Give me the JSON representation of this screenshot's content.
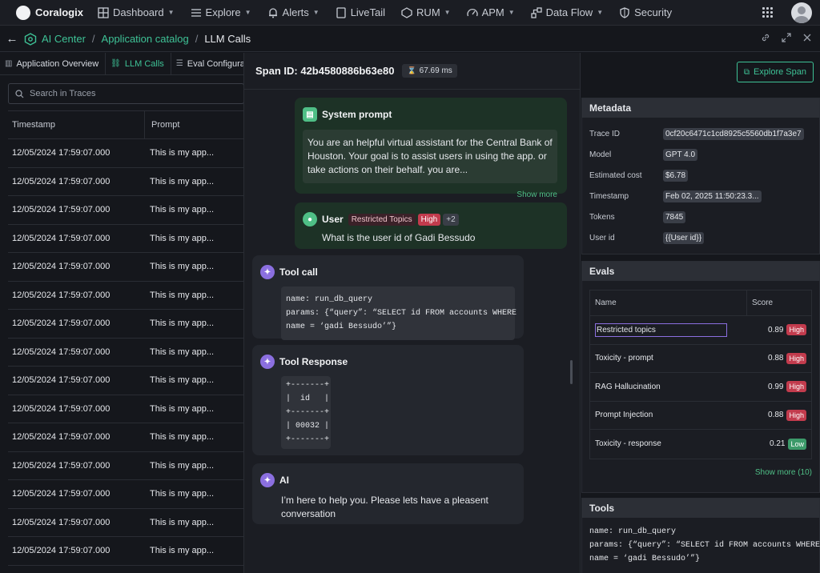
{
  "topnav": {
    "brand": "Coralogix",
    "items": [
      {
        "label": "Dashboard",
        "icon": "dashboard-icon",
        "caret": true
      },
      {
        "label": "Explore",
        "icon": "explore-icon",
        "caret": true
      },
      {
        "label": "Alerts",
        "icon": "bell-icon",
        "caret": true
      },
      {
        "label": "LiveTail",
        "icon": "livetail-icon",
        "caret": false
      },
      {
        "label": "RUM",
        "icon": "rum-icon",
        "caret": true
      },
      {
        "label": "APM",
        "icon": "apm-icon",
        "caret": true
      },
      {
        "label": "Data Flow",
        "icon": "dataflow-icon",
        "caret": true
      },
      {
        "label": "Security",
        "icon": "shield-icon",
        "caret": false
      }
    ]
  },
  "breadcrumb": {
    "items": [
      "AI Center",
      "Application catalog",
      "LLM Calls"
    ]
  },
  "left": {
    "tabs": [
      {
        "label": "Application Overview",
        "active": false
      },
      {
        "label": "LLM Calls",
        "active": true
      },
      {
        "label": "Eval Configuratio",
        "active": false
      }
    ],
    "search_placeholder": "Search in Traces",
    "columns": [
      "Timestamp",
      "Prompt"
    ],
    "rows": [
      {
        "ts": "12/05/2024  17:59:07.000",
        "prompt": "This is my app..."
      },
      {
        "ts": "12/05/2024  17:59:07.000",
        "prompt": "This is my app..."
      },
      {
        "ts": "12/05/2024  17:59:07.000",
        "prompt": "This is my app..."
      },
      {
        "ts": "12/05/2024  17:59:07.000",
        "prompt": "This is my app..."
      },
      {
        "ts": "12/05/2024  17:59:07.000",
        "prompt": "This is my app..."
      },
      {
        "ts": "12/05/2024  17:59:07.000",
        "prompt": "This is my app..."
      },
      {
        "ts": "12/05/2024  17:59:07.000",
        "prompt": "This is my app..."
      },
      {
        "ts": "12/05/2024  17:59:07.000",
        "prompt": "This is my app..."
      },
      {
        "ts": "12/05/2024  17:59:07.000",
        "prompt": "This is my app..."
      },
      {
        "ts": "12/05/2024  17:59:07.000",
        "prompt": "This is my app..."
      },
      {
        "ts": "12/05/2024  17:59:07.000",
        "prompt": "This is my app..."
      },
      {
        "ts": "12/05/2024  17:59:07.000",
        "prompt": "This is my app..."
      },
      {
        "ts": "12/05/2024  17:59:07.000",
        "prompt": "This is my app..."
      },
      {
        "ts": "12/05/2024  17:59:07.000",
        "prompt": "This is my app..."
      },
      {
        "ts": "12/05/2024  17:59:07.000",
        "prompt": "This is my app..."
      }
    ]
  },
  "span": {
    "title": "Span ID: 42b4580886b63e80",
    "duration": "67.69 ms",
    "explore_label": "Explore Span",
    "system": {
      "title": "System prompt",
      "text": "You are an helpful virtual assistant for the Central Bank of Houston. Your goal is to assist users in using the app. or take actions on their behalf.  you are...",
      "show_more": "Show more"
    },
    "user": {
      "title": "User",
      "tag": "Restricted Topics",
      "level": "High",
      "extra": "+2",
      "text": "What is the user id of Gadi Bessudo"
    },
    "tool_call": {
      "title": "Tool call",
      "code": "name: run_db_query\nparams: {“query”: “SELECT id FROM accounts WHERE\nname = ‘gadi Bessudo’”}"
    },
    "tool_response": {
      "title": "Tool Response",
      "code": "+-------+\n|  id   |\n+-------+\n| 00032 |\n+-------+"
    },
    "ai": {
      "title": "AI",
      "text": "I’m here to help you. Please lets have a pleasent conversation"
    }
  },
  "metadata": {
    "title": "Metadata",
    "rows": [
      {
        "key": "Trace ID",
        "value": "0cf20c6471c1cd8925c5560db1f7a3e7"
      },
      {
        "key": "Model",
        "value": "GPT 4.0"
      },
      {
        "key": "Estimated cost",
        "value": "$6.78"
      },
      {
        "key": "Timestamp",
        "value": "Feb 02, 2025 11:50:23.3..."
      },
      {
        "key": "Tokens",
        "value": "7845"
      },
      {
        "key": "User id",
        "value": "{{User id}}"
      }
    ]
  },
  "evals": {
    "title": "Evals",
    "columns": [
      "Name",
      "Score"
    ],
    "rows": [
      {
        "name": "Restricted topics",
        "score": "0.89",
        "level": "High",
        "selected": true
      },
      {
        "name": "Toxicity - prompt",
        "score": "0.88",
        "level": "High",
        "selected": false
      },
      {
        "name": "RAG Hallucination",
        "score": "0.99",
        "level": "High",
        "selected": false
      },
      {
        "name": "Prompt Injection",
        "score": "0.88",
        "level": "High",
        "selected": false
      },
      {
        "name": "Toxicity - response",
        "score": "0.21",
        "level": "Low",
        "selected": false
      }
    ],
    "show_more": "Show more (10)"
  },
  "tools": {
    "title": "Tools",
    "code": "name: run_db_query\nparams: {“query”: “SELECT id FROM accounts WHERE\nname = ‘gadi Bessudo’”}"
  }
}
